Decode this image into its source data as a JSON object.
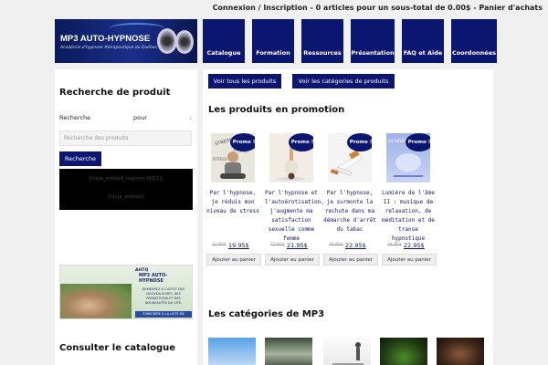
{
  "topbar": {
    "account_link": "Connexion / Inscription",
    "separator1": " - ",
    "cart_summary": "0 articles pour un sous-total de 0.00$",
    "separator2": " - ",
    "cart_link": "Panier d'achats"
  },
  "logo": {
    "title": "MP3 AUTO-HYPNOSE",
    "subtitle": "Académie d'hypnose thérapeutique du Québec"
  },
  "nav": {
    "items": [
      "Catalogue",
      "Formation",
      "Ressources",
      "Présentation",
      "FAQ et Aide",
      "Coordonnées"
    ]
  },
  "sidebar": {
    "search_title": "Recherche de produit",
    "search_label_left": "Recherche",
    "search_label_mid": "pour",
    "search_label_right": ":",
    "search_placeholder": "Recherche des produits",
    "search_button": "Recherche",
    "widget_line1": "[ninja_embed_register-[6][1]]",
    "widget_line2": "[ninja_embed]",
    "banner": {
      "brand_small": "AHTQ",
      "brand": "MP3 AUTO-HYPNOSE",
      "text": "DEMEUREZ À L'AFFÛT DES NOUVEAUX MP3, DES PROMOTIONS ET DES NOUVEAUTÉS DU SITE.",
      "cta": "S'INSCRIRE À LA LISTE DE DIFFUSION"
    },
    "catalogue_title": "Consulter le catalogue"
  },
  "main": {
    "btn_all_products": "Voir tous les produits",
    "btn_all_categories": "Voir les catégories de produits",
    "promo_title": "Les produits en promotion",
    "categories_title": "Les catégories de MP3",
    "products": [
      {
        "badge": "Promo !",
        "name": "Par l'hypnose, je réduis mon niveau de stress",
        "old_price": "21.95$",
        "new_price": "19.95$",
        "cart": "Ajouter au panier",
        "thumb_color": "#e9e6de"
      },
      {
        "badge": "Promo !",
        "name": "Par l'hypnose et l'autoérotisation, j'augmente ma satisfaction sexuelle comme femme",
        "old_price": "22.95$",
        "new_price": "21.95$",
        "cart": "Ajouter au panier",
        "thumb_color": "#f2ece4"
      },
      {
        "badge": "Promo !",
        "name": "Par l'hypnose, je surmonte la rechute dans ma démarche d'arrêt du tabac",
        "old_price": "24.95$",
        "new_price": "22.95$",
        "cart": "Ajouter au panier",
        "thumb_color": "#f4f4f4"
      },
      {
        "badge": "Promo !",
        "name": "Lumière de l'âme II : musique de relaxation, de méditation et de transe hypnotique",
        "old_price": "24.95$",
        "new_price": "22.95$",
        "cart": "Ajouter au panier",
        "thumb_color": "#b9c6ee"
      }
    ]
  }
}
